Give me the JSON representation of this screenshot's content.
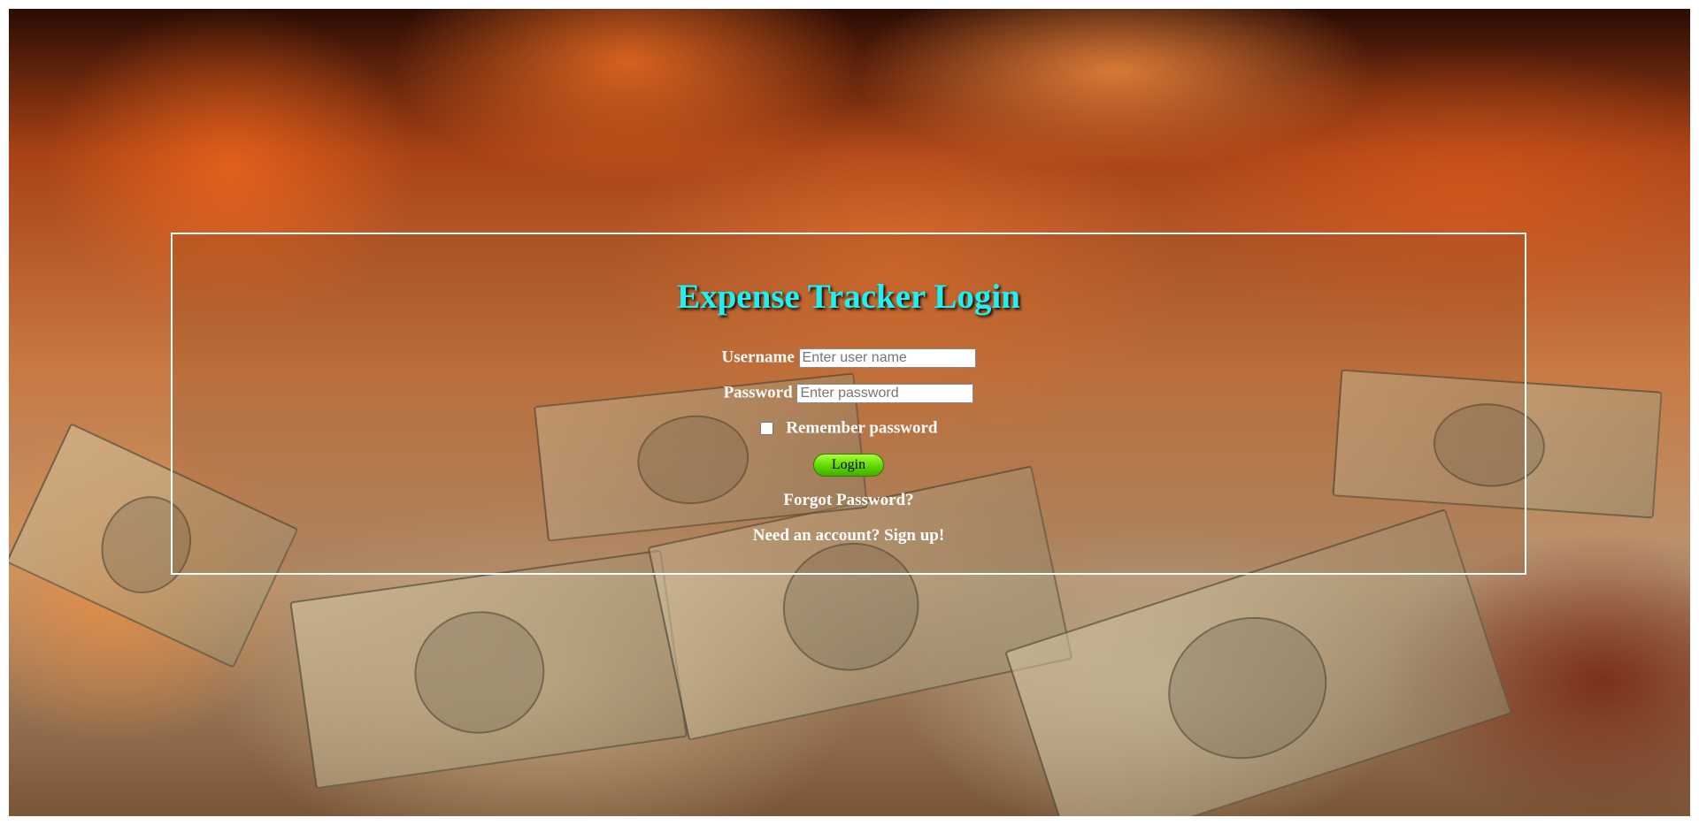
{
  "login": {
    "title": "Expense Tracker Login",
    "username_label": "Username",
    "username_placeholder": "Enter user name",
    "password_label": "Password",
    "password_placeholder": "Enter password",
    "remember_label": "Remember password",
    "remember_checked": false,
    "login_button": "Login",
    "forgot_password": "Forgot Password?",
    "signup": "Need an account? Sign up!"
  },
  "colors": {
    "title": "#20f0f0",
    "login_button": "#5fd600",
    "box_border": "#ffffff",
    "text": "#ffffff"
  }
}
